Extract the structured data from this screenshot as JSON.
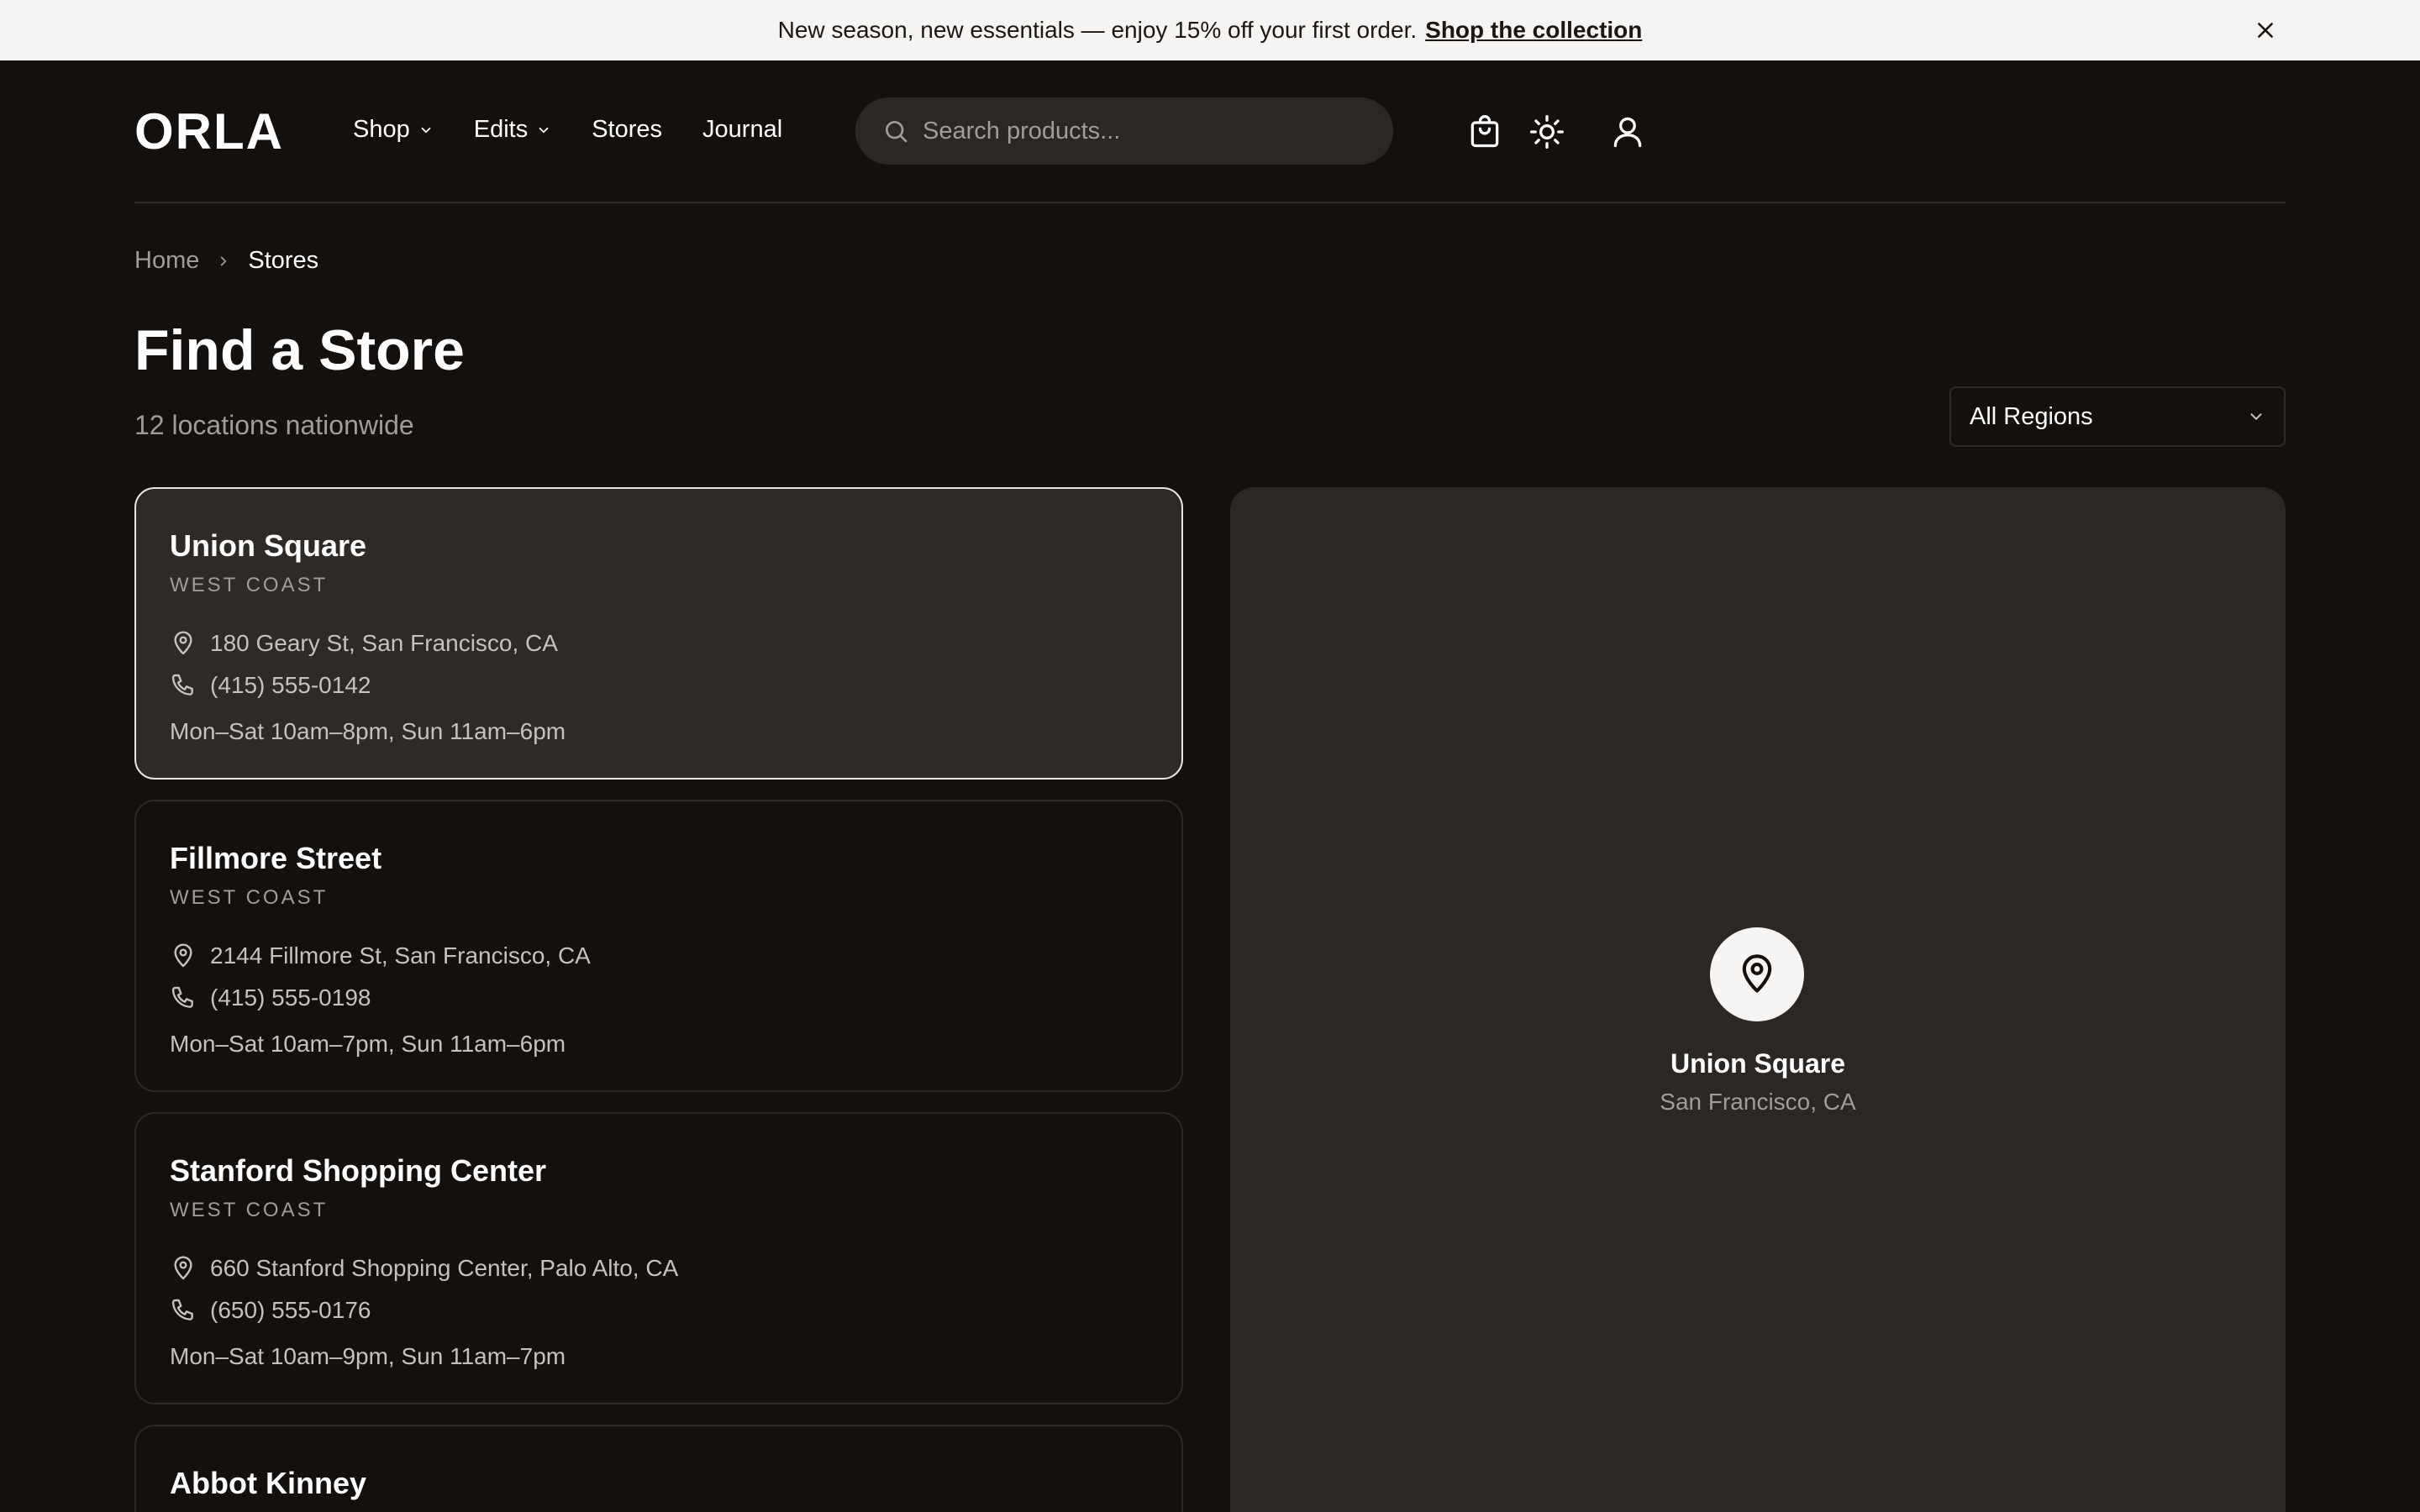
{
  "announcement": {
    "message": "New season, new essentials — enjoy 15% off your first order.",
    "link_label": "Shop the collection"
  },
  "header": {
    "logo": "ORLA",
    "nav": [
      {
        "label": "Shop",
        "has_dropdown": true
      },
      {
        "label": "Edits",
        "has_dropdown": true
      },
      {
        "label": "Stores",
        "has_dropdown": false
      },
      {
        "label": "Journal",
        "has_dropdown": false
      }
    ],
    "search_placeholder": "Search products...",
    "icons": [
      "cart-icon",
      "theme-toggle-icon",
      "account-icon"
    ]
  },
  "breadcrumb": {
    "home": "Home",
    "current": "Stores"
  },
  "page": {
    "title": "Find a Store",
    "subtitle": "12 locations nationwide",
    "region_filter": "All Regions"
  },
  "stores": [
    {
      "name": "Union Square",
      "region": "WEST COAST",
      "address": "180 Geary St, San Francisco, CA",
      "phone": "(415) 555-0142",
      "hours": "Mon–Sat 10am–8pm, Sun 11am–6pm",
      "active": true
    },
    {
      "name": "Fillmore Street",
      "region": "WEST COAST",
      "address": "2144 Fillmore St, San Francisco, CA",
      "phone": "(415) 555-0198",
      "hours": "Mon–Sat 10am–7pm, Sun 11am–6pm",
      "active": false
    },
    {
      "name": "Stanford Shopping Center",
      "region": "WEST COAST",
      "address": "660 Stanford Shopping Center, Palo Alto, CA",
      "phone": "(650) 555-0176",
      "hours": "Mon–Sat 10am–9pm, Sun 11am–7pm",
      "active": false
    },
    {
      "name": "Abbot Kinney",
      "region": "",
      "address": "",
      "phone": "",
      "hours": "",
      "active": false
    }
  ],
  "map": {
    "store_name": "Union Square",
    "city": "San Francisco, CA"
  },
  "colors": {
    "background": "#13100e",
    "card_active": "#2e2a27",
    "map_panel": "#2b2725",
    "muted_text": "#a19c97",
    "announcement_bg": "#f6f5f3"
  }
}
